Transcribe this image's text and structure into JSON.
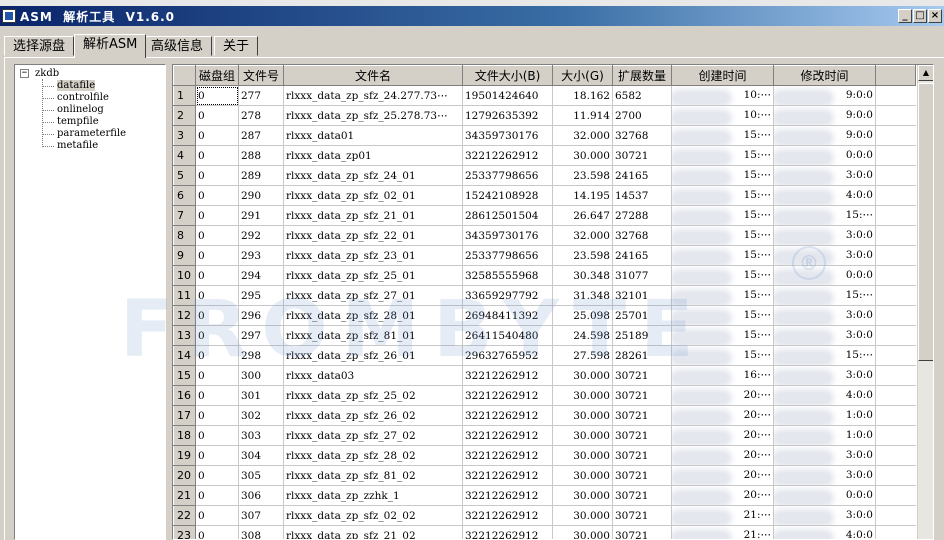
{
  "window": {
    "title": "ASM  解析工具  V1.6.0",
    "controls": [
      "_",
      "□",
      "×"
    ]
  },
  "tabs": [
    {
      "label": "选择源盘",
      "active": false
    },
    {
      "label": "解析ASM",
      "active": true
    },
    {
      "label": "高级信息",
      "active": false
    },
    {
      "label": "关于",
      "active": false
    }
  ],
  "tree": {
    "root": "zkdb",
    "expander": "−",
    "items": [
      "datafile",
      "controlfile",
      "onlinelog",
      "tempfile",
      "parameterfile",
      "metafile"
    ],
    "selected": "datafile"
  },
  "table": {
    "columns": [
      "磁盘组",
      "文件号",
      "文件名",
      "文件大小(B)",
      "大小(G)",
      "扩展数量",
      "创建时间",
      "修改时间"
    ],
    "rows": [
      {
        "n": "1",
        "dg": "0",
        "fno": "277",
        "name": "rlxxx_data_zp_sfz_24.277.73⋯",
        "bytes": "19501424640",
        "gb": "18.162",
        "ext": "6582",
        "ctime": "10:⋯",
        "mtime": "9:0:0"
      },
      {
        "n": "2",
        "dg": "0",
        "fno": "278",
        "name": "rlxxx_data_zp_sfz_25.278.73⋯",
        "bytes": "12792635392",
        "gb": "11.914",
        "ext": "2700",
        "ctime": "10:⋯",
        "mtime": "9:0:0"
      },
      {
        "n": "3",
        "dg": "0",
        "fno": "287",
        "name": "rlxxx_data01",
        "bytes": "34359730176",
        "gb": "32.000",
        "ext": "32768",
        "ctime": "15:⋯",
        "mtime": "9:0:0"
      },
      {
        "n": "4",
        "dg": "0",
        "fno": "288",
        "name": "rlxxx_data_zp01",
        "bytes": "32212262912",
        "gb": "30.000",
        "ext": "30721",
        "ctime": "15:⋯",
        "mtime": "0:0:0"
      },
      {
        "n": "5",
        "dg": "0",
        "fno": "289",
        "name": "rlxxx_data_zp_sfz_24_01",
        "bytes": "25337798656",
        "gb": "23.598",
        "ext": "24165",
        "ctime": "15:⋯",
        "mtime": "3:0:0"
      },
      {
        "n": "6",
        "dg": "0",
        "fno": "290",
        "name": "rlxxx_data_zp_sfz_02_01",
        "bytes": "15242108928",
        "gb": "14.195",
        "ext": "14537",
        "ctime": "15:⋯",
        "mtime": "4:0:0"
      },
      {
        "n": "7",
        "dg": "0",
        "fno": "291",
        "name": "rlxxx_data_zp_sfz_21_01",
        "bytes": "28612501504",
        "gb": "26.647",
        "ext": "27288",
        "ctime": "15:⋯",
        "mtime": "15:⋯"
      },
      {
        "n": "8",
        "dg": "0",
        "fno": "292",
        "name": "rlxxx_data_zp_sfz_22_01",
        "bytes": "34359730176",
        "gb": "32.000",
        "ext": "32768",
        "ctime": "15:⋯",
        "mtime": "3:0:0"
      },
      {
        "n": "9",
        "dg": "0",
        "fno": "293",
        "name": "rlxxx_data_zp_sfz_23_01",
        "bytes": "25337798656",
        "gb": "23.598",
        "ext": "24165",
        "ctime": "15:⋯",
        "mtime": "3:0:0"
      },
      {
        "n": "10",
        "dg": "0",
        "fno": "294",
        "name": "rlxxx_data_zp_sfz_25_01",
        "bytes": "32585555968",
        "gb": "30.348",
        "ext": "31077",
        "ctime": "15:⋯",
        "mtime": "0:0:0"
      },
      {
        "n": "11",
        "dg": "0",
        "fno": "295",
        "name": "rlxxx_data_zp_sfz_27_01",
        "bytes": "33659297792",
        "gb": "31.348",
        "ext": "32101",
        "ctime": "15:⋯",
        "mtime": "15:⋯"
      },
      {
        "n": "12",
        "dg": "0",
        "fno": "296",
        "name": "rlxxx_data_zp_sfz_28_01",
        "bytes": "26948411392",
        "gb": "25.098",
        "ext": "25701",
        "ctime": "15:⋯",
        "mtime": "3:0:0"
      },
      {
        "n": "13",
        "dg": "0",
        "fno": "297",
        "name": "rlxxx_data_zp_sfz_81_01",
        "bytes": "26411540480",
        "gb": "24.598",
        "ext": "25189",
        "ctime": "15:⋯",
        "mtime": "3:0:0"
      },
      {
        "n": "14",
        "dg": "0",
        "fno": "298",
        "name": "rlxxx_data_zp_sfz_26_01",
        "bytes": "29632765952",
        "gb": "27.598",
        "ext": "28261",
        "ctime": "15:⋯",
        "mtime": "15:⋯"
      },
      {
        "n": "15",
        "dg": "0",
        "fno": "300",
        "name": "rlxxx_data03",
        "bytes": "32212262912",
        "gb": "30.000",
        "ext": "30721",
        "ctime": "16:⋯",
        "mtime": "3:0:0"
      },
      {
        "n": "16",
        "dg": "0",
        "fno": "301",
        "name": "rlxxx_data_zp_sfz_25_02",
        "bytes": "32212262912",
        "gb": "30.000",
        "ext": "30721",
        "ctime": "20:⋯",
        "mtime": "4:0:0"
      },
      {
        "n": "17",
        "dg": "0",
        "fno": "302",
        "name": "rlxxx_data_zp_sfz_26_02",
        "bytes": "32212262912",
        "gb": "30.000",
        "ext": "30721",
        "ctime": "20:⋯",
        "mtime": "1:0:0"
      },
      {
        "n": "18",
        "dg": "0",
        "fno": "303",
        "name": "rlxxx_data_zp_sfz_27_02",
        "bytes": "32212262912",
        "gb": "30.000",
        "ext": "30721",
        "ctime": "20:⋯",
        "mtime": "1:0:0"
      },
      {
        "n": "19",
        "dg": "0",
        "fno": "304",
        "name": "rlxxx_data_zp_sfz_28_02",
        "bytes": "32212262912",
        "gb": "30.000",
        "ext": "30721",
        "ctime": "20:⋯",
        "mtime": "3:0:0"
      },
      {
        "n": "20",
        "dg": "0",
        "fno": "305",
        "name": "rlxxx_data_zp_sfz_81_02",
        "bytes": "32212262912",
        "gb": "30.000",
        "ext": "30721",
        "ctime": "20:⋯",
        "mtime": "3:0:0"
      },
      {
        "n": "21",
        "dg": "0",
        "fno": "306",
        "name": "rlxxx_data_zp_zzhk_1",
        "bytes": "32212262912",
        "gb": "30.000",
        "ext": "30721",
        "ctime": "20:⋯",
        "mtime": "0:0:0"
      },
      {
        "n": "22",
        "dg": "0",
        "fno": "307",
        "name": "rlxxx_data_zp_sfz_02_02",
        "bytes": "32212262912",
        "gb": "30.000",
        "ext": "30721",
        "ctime": "21:⋯",
        "mtime": "3:0:0"
      },
      {
        "n": "23",
        "dg": "0",
        "fno": "308",
        "name": "rlxxx_data_zp_sfz_21_02",
        "bytes": "32212262912",
        "gb": "30.000",
        "ext": "30721",
        "ctime": "21:⋯",
        "mtime": "4:0:0"
      }
    ]
  },
  "scrollbar": {
    "up_arrow": "▲"
  },
  "watermark": {
    "registered": "®"
  }
}
